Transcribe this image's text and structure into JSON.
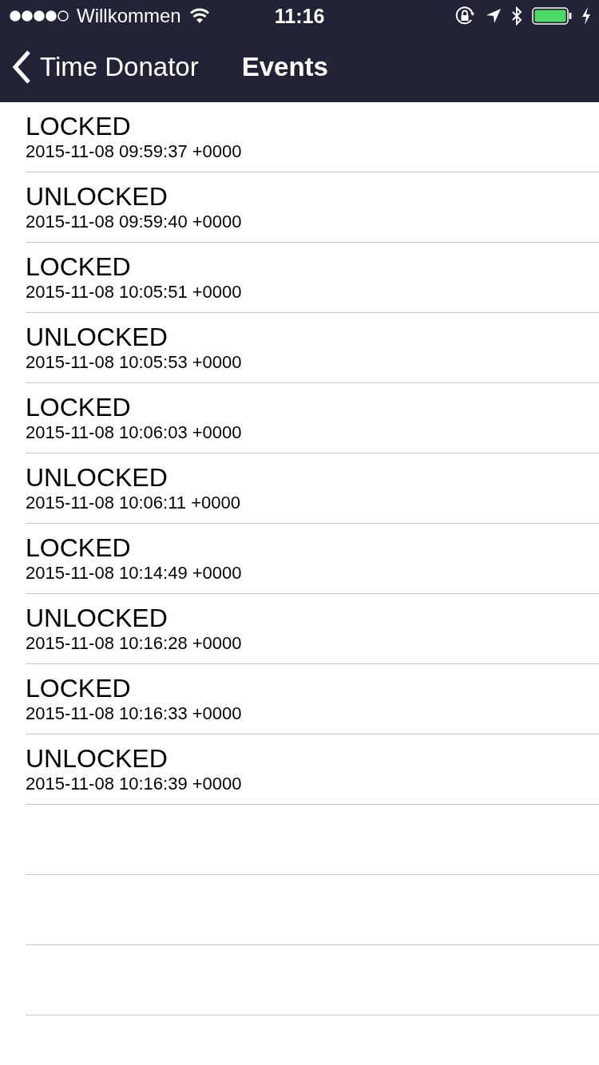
{
  "status_bar": {
    "carrier": "Willkommen",
    "time": "11:16"
  },
  "nav_bar": {
    "back_label": "Time Donator",
    "title": "Events"
  },
  "events": [
    {
      "state": "LOCKED",
      "timestamp": "2015-11-08 09:59:37 +0000"
    },
    {
      "state": "UNLOCKED",
      "timestamp": "2015-11-08 09:59:40 +0000"
    },
    {
      "state": "LOCKED",
      "timestamp": "2015-11-08 10:05:51 +0000"
    },
    {
      "state": "UNLOCKED",
      "timestamp": "2015-11-08 10:05:53 +0000"
    },
    {
      "state": "LOCKED",
      "timestamp": "2015-11-08 10:06:03 +0000"
    },
    {
      "state": "UNLOCKED",
      "timestamp": "2015-11-08 10:06:11 +0000"
    },
    {
      "state": "LOCKED",
      "timestamp": "2015-11-08 10:14:49 +0000"
    },
    {
      "state": "UNLOCKED",
      "timestamp": "2015-11-08 10:16:28 +0000"
    },
    {
      "state": "LOCKED",
      "timestamp": "2015-11-08 10:16:33 +0000"
    },
    {
      "state": "UNLOCKED",
      "timestamp": "2015-11-08 10:16:39 +0000"
    }
  ]
}
